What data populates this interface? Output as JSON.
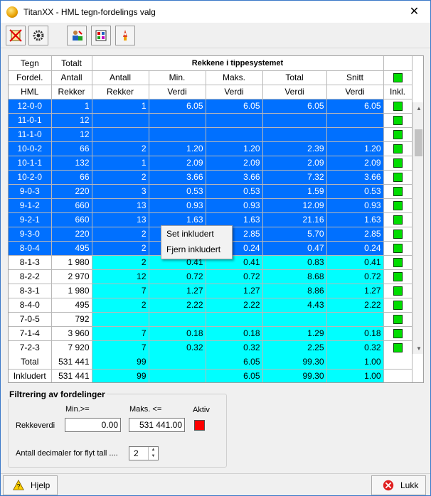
{
  "window": {
    "title": "TitanXX - HML tegn-fordelings valg",
    "close": "✕"
  },
  "header": {
    "row1": [
      "Tegn",
      "Totalt",
      "Rekkene i tippesystemet"
    ],
    "row2": [
      "Fordel.",
      "Antall",
      "Antall",
      "Min.",
      "Maks.",
      "Total",
      "Snitt"
    ],
    "row3": [
      "HML",
      "Rekker",
      "Rekker",
      "Verdi",
      "Verdi",
      "Verdi",
      "Verdi",
      "Inkl."
    ]
  },
  "rows": [
    {
      "hml": "12-0-0",
      "totalt": "1",
      "antall": "1",
      "min": "6.05",
      "maks": "6.05",
      "total": "6.05",
      "snitt": "6.05",
      "sel": true
    },
    {
      "hml": "11-0-1",
      "totalt": "12",
      "antall": "",
      "min": "",
      "maks": "",
      "total": "",
      "snitt": "",
      "sel": true
    },
    {
      "hml": "11-1-0",
      "totalt": "12",
      "antall": "",
      "min": "",
      "maks": "",
      "total": "",
      "snitt": "",
      "sel": true
    },
    {
      "hml": "10-0-2",
      "totalt": "66",
      "antall": "2",
      "min": "1.20",
      "maks": "1.20",
      "total": "2.39",
      "snitt": "1.20",
      "sel": true
    },
    {
      "hml": "10-1-1",
      "totalt": "132",
      "antall": "1",
      "min": "2.09",
      "maks": "2.09",
      "total": "2.09",
      "snitt": "2.09",
      "sel": true
    },
    {
      "hml": "10-2-0",
      "totalt": "66",
      "antall": "2",
      "min": "3.66",
      "maks": "3.66",
      "total": "7.32",
      "snitt": "3.66",
      "sel": true
    },
    {
      "hml": "9-0-3",
      "totalt": "220",
      "antall": "3",
      "min": "0.53",
      "maks": "0.53",
      "total": "1.59",
      "snitt": "0.53",
      "sel": true
    },
    {
      "hml": "9-1-2",
      "totalt": "660",
      "antall": "13",
      "min": "0.93",
      "maks": "0.93",
      "total": "12.09",
      "snitt": "0.93",
      "sel": true
    },
    {
      "hml": "9-2-1",
      "totalt": "660",
      "antall": "13",
      "min": "1.63",
      "maks": "1.63",
      "total": "21.16",
      "snitt": "1.63",
      "sel": true
    },
    {
      "hml": "9-3-0",
      "totalt": "220",
      "antall": "2",
      "min": "",
      "maks": "2.85",
      "total": "5.70",
      "snitt": "2.85",
      "sel": true
    },
    {
      "hml": "8-0-4",
      "totalt": "495",
      "antall": "2",
      "min": "",
      "maks": "0.24",
      "total": "0.47",
      "snitt": "0.24",
      "sel": true
    },
    {
      "hml": "8-1-3",
      "totalt": "1 980",
      "antall": "2",
      "min": "0.41",
      "maks": "0.41",
      "total": "0.83",
      "snitt": "0.41",
      "sel": false
    },
    {
      "hml": "8-2-2",
      "totalt": "2 970",
      "antall": "12",
      "min": "0.72",
      "maks": "0.72",
      "total": "8.68",
      "snitt": "0.72",
      "sel": false
    },
    {
      "hml": "8-3-1",
      "totalt": "1 980",
      "antall": "7",
      "min": "1.27",
      "maks": "1.27",
      "total": "8.86",
      "snitt": "1.27",
      "sel": false
    },
    {
      "hml": "8-4-0",
      "totalt": "495",
      "antall": "2",
      "min": "2.22",
      "maks": "2.22",
      "total": "4.43",
      "snitt": "2.22",
      "sel": false
    },
    {
      "hml": "7-0-5",
      "totalt": "792",
      "antall": "",
      "min": "",
      "maks": "",
      "total": "",
      "snitt": "",
      "sel": false
    },
    {
      "hml": "7-1-4",
      "totalt": "3 960",
      "antall": "7",
      "min": "0.18",
      "maks": "0.18",
      "total": "1.29",
      "snitt": "0.18",
      "sel": false
    },
    {
      "hml": "7-2-3",
      "totalt": "7 920",
      "antall": "7",
      "min": "0.32",
      "maks": "0.32",
      "total": "2.25",
      "snitt": "0.32",
      "sel": false
    }
  ],
  "footer": {
    "total": {
      "label": "Total",
      "totalt": "531 441",
      "antall": "99",
      "min": "",
      "maks": "6.05",
      "total": "99.30",
      "snitt": "1.00"
    },
    "inkl": {
      "label": "Inkludert",
      "totalt": "531 441",
      "antall": "99",
      "min": "",
      "maks": "6.05",
      "total": "99.30",
      "snitt": "1.00"
    }
  },
  "context_menu": [
    "Set inkludert",
    "Fjern inkludert"
  ],
  "filter": {
    "title": "Filtrering av fordelinger",
    "min_label": "Min.>=",
    "max_label": "Maks. <=",
    "aktiv_label": "Aktiv",
    "row_label": "Rekkeverdi",
    "min_value": "0.00",
    "max_value": "531 441.00",
    "decimals_label": "Antall decimaler for flyt tall ....",
    "decimals_value": "2"
  },
  "buttons": {
    "help": "Hjelp",
    "close": "Lukk"
  },
  "colors": {
    "selected": "#0070ff",
    "cyan": "#00ffff",
    "check": "#00dd00",
    "aktiv": "#ff0000"
  }
}
